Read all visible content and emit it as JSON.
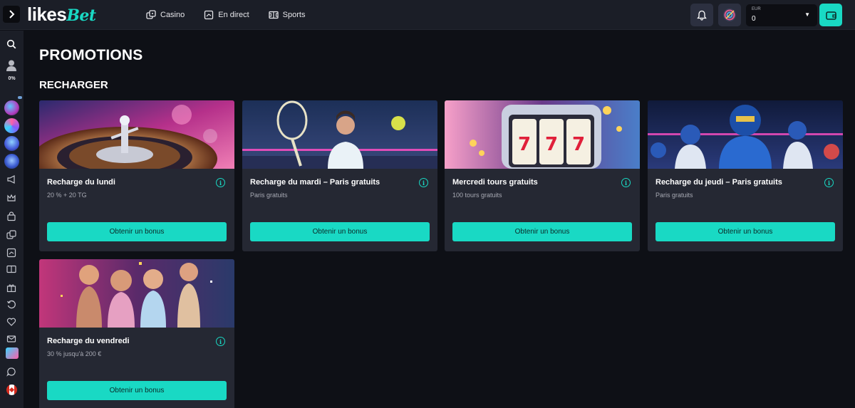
{
  "brand": {
    "logo_part1": "likes",
    "logo_part2": "Bet"
  },
  "nav": [
    {
      "label": "Casino",
      "icon": "dice-icon"
    },
    {
      "label": "En direct",
      "icon": "live-icon"
    },
    {
      "label": "Sports",
      "icon": "sports-field-icon"
    }
  ],
  "header": {
    "currency": "EUR",
    "balance": "0"
  },
  "sidebar": {
    "progress": "0%",
    "progress_value": 0
  },
  "main": {
    "title": "PROMOTIONS",
    "section": "RECHARGER",
    "cards": [
      {
        "title": "Recharge du lundi",
        "subtitle": "20 % + 20 TG",
        "button": "Obtenir un bonus",
        "art": "roulette"
      },
      {
        "title": "Recharge du mardi – Paris gratuits",
        "subtitle": "Paris gratuits",
        "button": "Obtenir un bonus",
        "art": "tennis"
      },
      {
        "title": "Mercredi tours gratuits",
        "subtitle": "100 tours gratuits",
        "button": "Obtenir un bonus",
        "art": "slot"
      },
      {
        "title": "Recharge du jeudi – Paris gratuits",
        "subtitle": "Paris gratuits",
        "button": "Obtenir un bonus",
        "art": "football"
      },
      {
        "title": "Recharge du vendredi",
        "subtitle": "30 % jusqu'à 200 €",
        "button": "Obtenir un bonus",
        "art": "party"
      }
    ]
  },
  "colors": {
    "accent": "#19d9c4",
    "background": "#0e1016",
    "panel": "#1b1e27",
    "card": "#252833"
  }
}
